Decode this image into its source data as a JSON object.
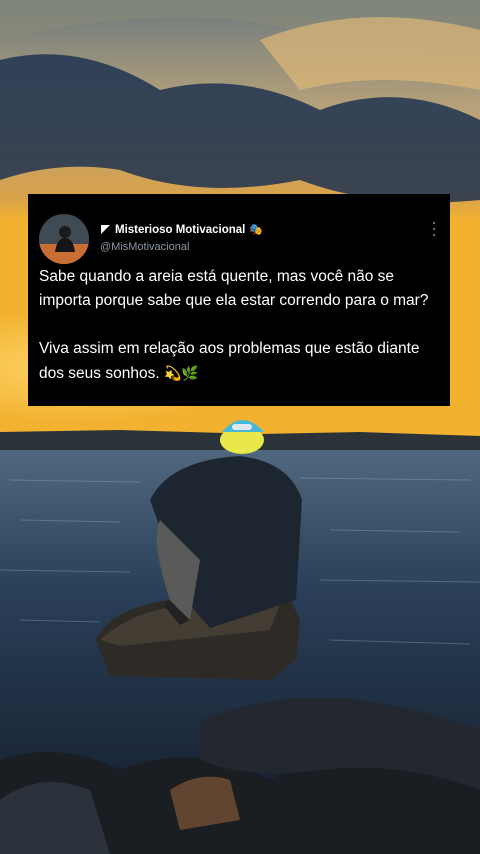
{
  "tweet": {
    "display_name": "Misterioso Motivacional",
    "handle": "@MisMotivacional",
    "paragraph1": "Sabe quando a areia está quente, mas você não se importa porque sabe que ela estar correndo para o mar?",
    "paragraph2": "Viva assim em relação aos problemas que estão diante dos seus sonhos.",
    "emojis": "💫🌿",
    "name_emoji": "🎭",
    "icons": [
      "flag-icon",
      "masks-icon",
      "more-icon"
    ]
  },
  "colors": {
    "card_bg": "#000000",
    "text": "#ffffff",
    "muted": "#8b98a5"
  }
}
